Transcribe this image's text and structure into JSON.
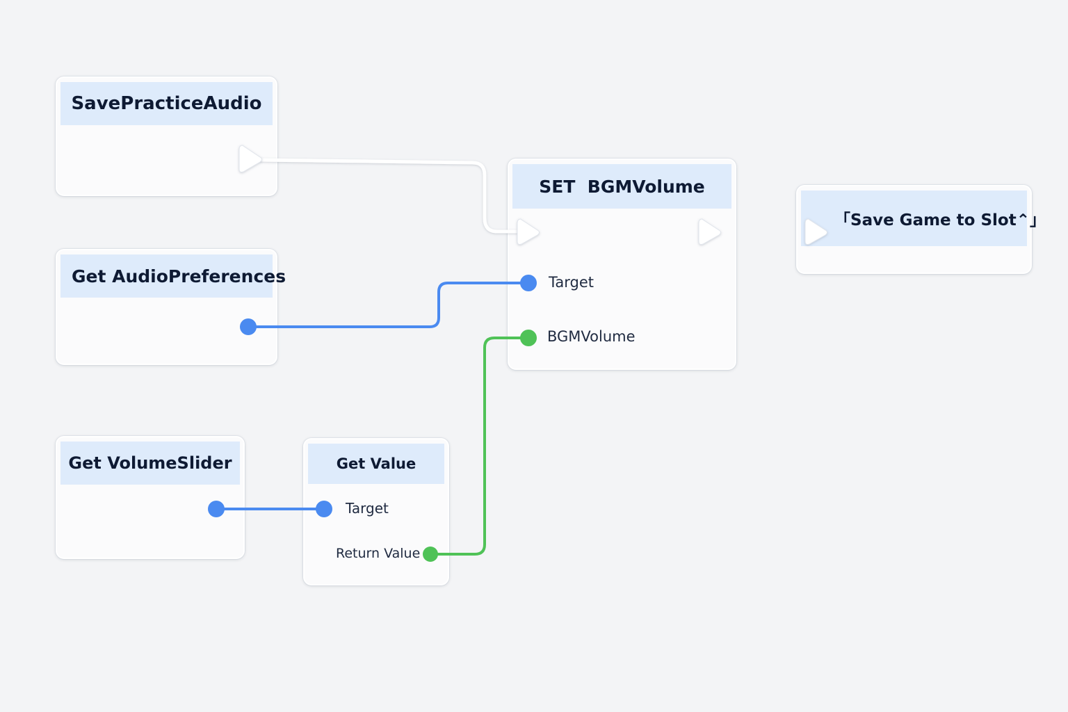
{
  "colors": {
    "canvas": "#f3f4f6",
    "node_body": "#fbfbfc",
    "node_header": "#deebfb",
    "exec_wire": "#ffffff",
    "object_pin": "#4a8af0",
    "float_pin": "#4fc257"
  },
  "nodes": {
    "save_practice_audio": {
      "title": "SavePracticeAudio"
    },
    "get_audio_preferences": {
      "title": "Get AudioPreferences"
    },
    "set_bgm_volume": {
      "title": "SET  BGMVolume",
      "pins": {
        "target": "Target",
        "bgm_volume": "BGMVolume"
      }
    },
    "save_game_to_slot": {
      "title": "「Save Game to Slot⌃」"
    },
    "get_volume_slider": {
      "title": "Get VolumeSlider"
    },
    "get_value": {
      "title": "Get Value",
      "pins": {
        "target": "Target",
        "return_value": "Return Value"
      }
    }
  },
  "icons": {
    "exec_pin": "exec-arrow-icon",
    "object_pin": "blue-dot-icon",
    "float_pin": "green-dot-icon"
  }
}
